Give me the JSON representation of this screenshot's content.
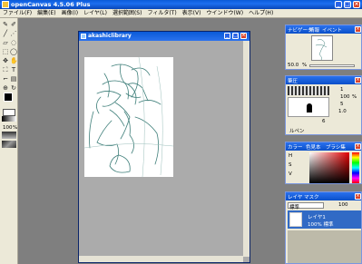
{
  "app": {
    "title": "openCanvas 4.5.06 Plus"
  },
  "menu": [
    "ファイル(F)",
    "編集(E)",
    "画像(I)",
    "レイヤ(L)",
    "選択範囲(S)",
    "フィルタ(T)",
    "表示(V)",
    "ウインドウ(W)",
    "ヘルプ(H)"
  ],
  "document": {
    "title": "akashiclibrary"
  },
  "navigator": {
    "tabs": [
      "ナビゲータ",
      "情報",
      "イベント"
    ],
    "zoom": "50.0"
  },
  "brush": {
    "title": "筆圧",
    "size": "1",
    "opacity": "100",
    "density": "5",
    "blur": "1.0",
    "opt": "6",
    "unit": "%",
    "name": "ルペン"
  },
  "color": {
    "tabs": [
      "カラー",
      "色見本",
      "ブラシ集"
    ],
    "labels": [
      "H",
      "S",
      "V"
    ]
  },
  "layer": {
    "tabs": [
      "レイヤ",
      "マスク"
    ],
    "mode": "標準",
    "opacity": "100",
    "layer_name": "レイヤ1",
    "layer_info": "100% 標準"
  },
  "toolbox": {
    "opacity": "100",
    "unit": "%"
  }
}
